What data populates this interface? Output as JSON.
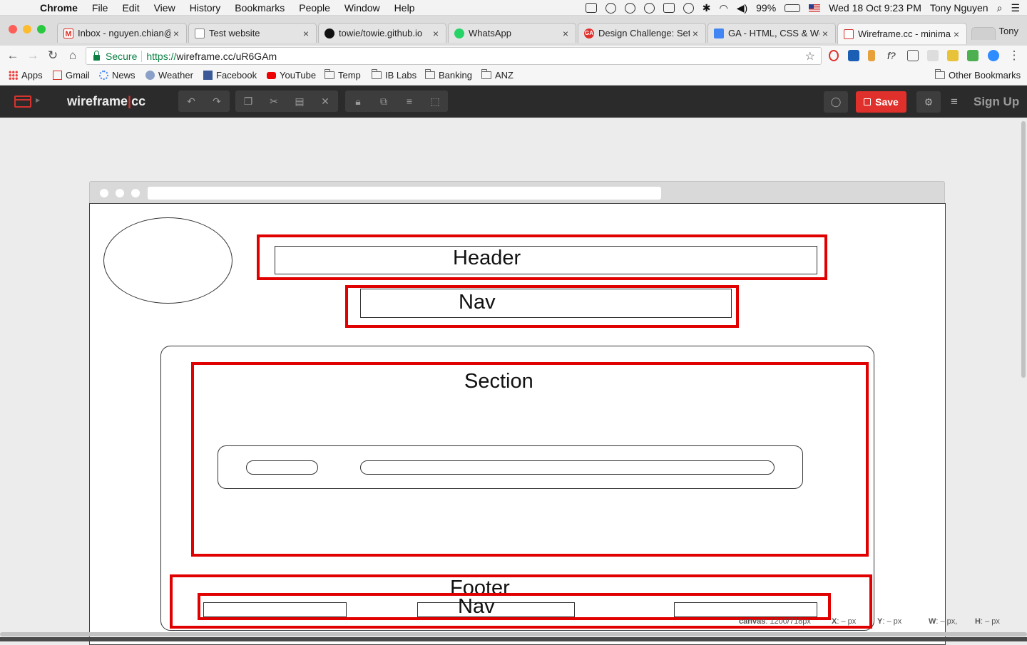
{
  "menubar": {
    "app": "Chrome",
    "items": [
      "File",
      "Edit",
      "View",
      "History",
      "Bookmarks",
      "People",
      "Window",
      "Help"
    ],
    "battery": "99%",
    "datetime": "Wed 18 Oct  9:23 PM",
    "user": "Tony Nguyen"
  },
  "tabs": [
    {
      "title": "Inbox - nguyen.chian@",
      "icon": "gmail-icon",
      "color": "#d93025"
    },
    {
      "title": "Test website",
      "icon": "page-icon",
      "color": "#888888"
    },
    {
      "title": "towie/towie.github.io",
      "icon": "github-icon",
      "color": "#111111"
    },
    {
      "title": "WhatsApp",
      "icon": "whatsapp-icon",
      "color": "#25d366"
    },
    {
      "title": "Design Challenge: Sett",
      "icon": "ga-icon",
      "color": "#e0302b"
    },
    {
      "title": "GA - HTML, CSS & We",
      "icon": "docs-icon",
      "color": "#4285f4"
    },
    {
      "title": "Wireframe.cc - minima",
      "icon": "wireframe-icon",
      "color": "#d6332e"
    }
  ],
  "profile": "Tony",
  "address": {
    "secure_label": "Secure",
    "scheme": "https://",
    "url": "wireframe.cc/uR6GAm"
  },
  "bookmarks": [
    {
      "label": "Apps",
      "icon": "apps-grid-icon"
    },
    {
      "label": "Gmail",
      "icon": "gmail-icon"
    },
    {
      "label": "News",
      "icon": "news-icon"
    },
    {
      "label": "Weather",
      "icon": "weather-icon"
    },
    {
      "label": "Facebook",
      "icon": "facebook-icon"
    },
    {
      "label": "YouTube",
      "icon": "youtube-icon"
    },
    {
      "label": "Temp",
      "icon": "folder-icon"
    },
    {
      "label": "IB Labs",
      "icon": "folder-icon"
    },
    {
      "label": "Banking",
      "icon": "folder-icon"
    },
    {
      "label": "ANZ",
      "icon": "folder-icon"
    }
  ],
  "other_bookmarks": "Other Bookmarks",
  "app": {
    "brand_left": "wireframe",
    "brand_pipe": "|",
    "brand_right": "cc",
    "save_label": "Save",
    "signup_label": "Sign Up",
    "accent": "#e0302b"
  },
  "wireframe": {
    "header": "Header",
    "nav_top": "Nav",
    "section": "Section",
    "footer": "Footer",
    "nav_bottom": "Nav"
  },
  "status": {
    "canvas_label": "canvas",
    "canvas_value": ": 1200/718px",
    "x_label": "X",
    "x_value": ": – px",
    "y_label": "Y",
    "y_value": ": – px",
    "w_label": "W",
    "w_value": ": – px,",
    "h_label": "H",
    "h_value": ": – px"
  }
}
